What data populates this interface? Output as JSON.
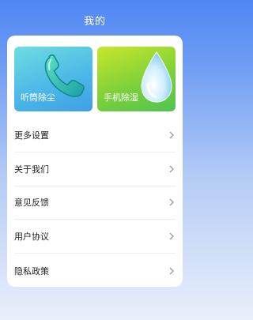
{
  "header": {
    "title": "我的"
  },
  "features": [
    {
      "label": "听筒除尘",
      "icon": "phone-icon"
    },
    {
      "label": "手机除湿",
      "icon": "water-drop-icon"
    }
  ],
  "menu": [
    {
      "label": "更多设置"
    },
    {
      "label": "关于我们"
    },
    {
      "label": "意见反馈"
    },
    {
      "label": "用户协议"
    },
    {
      "label": "隐私政策"
    }
  ],
  "colors": {
    "header_gradient_top": "#4f87f4",
    "dust_tile": "#4cb9e8",
    "humid_tile": "#7fd13a",
    "chevron": "#9a9a9a"
  }
}
